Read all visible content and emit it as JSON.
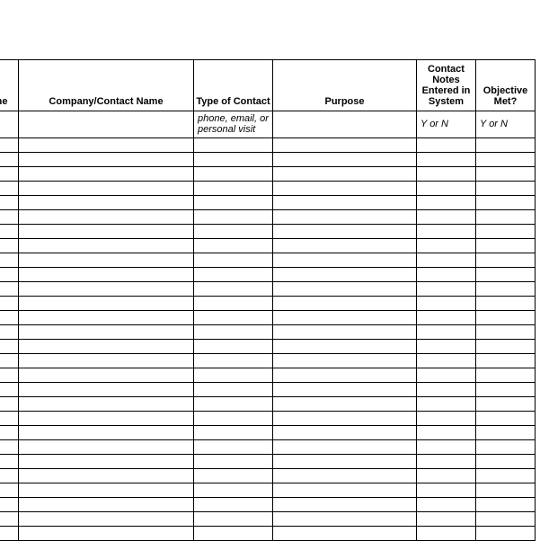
{
  "table": {
    "headers": {
      "col1": "me",
      "col2": "Company/Contact Name",
      "col3": "Type of Contact",
      "col4": "Purpose",
      "col5": "Contact Notes Entered in System",
      "col6": "Objective Met?"
    },
    "subheaders": {
      "col1": "",
      "col2": "",
      "col3": "phone, email, or personal visit",
      "col4": "",
      "col5": "Y or N",
      "col6": "Y or N"
    },
    "row_count": 28
  }
}
